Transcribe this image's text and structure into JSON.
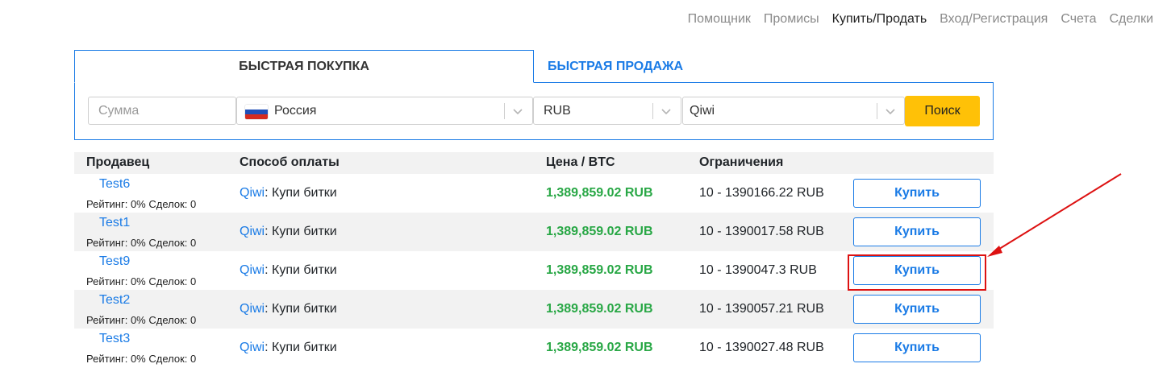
{
  "nav": {
    "items": [
      "Помощник",
      "Промисы",
      "Купить/Продать",
      "Вход/Регистрация",
      "Счета",
      "Сделки"
    ]
  },
  "tabs": {
    "buy": "БЫСТРАЯ ПОКУПКА",
    "sell": "БЫСТРАЯ ПРОДАЖА"
  },
  "search": {
    "amount_placeholder": "Сумма",
    "country": "Россия",
    "currency": "RUB",
    "payment": "Qiwi",
    "button": "Поиск"
  },
  "table": {
    "headers": {
      "seller": "Продавец",
      "payment": "Способ оплаты",
      "price": "Цена / BTC",
      "limits": "Ограничения"
    },
    "rows": [
      {
        "name": "Test6",
        "stats": "Рейтинг: 0% Сделок: 0",
        "method": "Qiwi",
        "method_suffix": ": Купи битки",
        "price": "1,389,859.02 RUB",
        "limits": "10 - 1390166.22 RUB",
        "button": "Купить"
      },
      {
        "name": "Test1",
        "stats": "Рейтинг: 0% Сделок: 0",
        "method": "Qiwi",
        "method_suffix": ": Купи битки",
        "price": "1,389,859.02 RUB",
        "limits": "10 - 1390017.58 RUB",
        "button": "Купить"
      },
      {
        "name": "Test9",
        "stats": "Рейтинг: 0% Сделок: 0",
        "method": "Qiwi",
        "method_suffix": ": Купи битки",
        "price": "1,389,859.02 RUB",
        "limits": "10 - 1390047.3 RUB",
        "button": "Купить"
      },
      {
        "name": "Test2",
        "stats": "Рейтинг: 0% Сделок: 0",
        "method": "Qiwi",
        "method_suffix": ": Купи битки",
        "price": "1,389,859.02 RUB",
        "limits": "10 - 1390057.21 RUB",
        "button": "Купить"
      },
      {
        "name": "Test3",
        "stats": "Рейтинг: 0% Сделок: 0",
        "method": "Qiwi",
        "method_suffix": ": Купи битки",
        "price": "1,389,859.02 RUB",
        "limits": "10 - 1390027.48 RUB",
        "button": "Купить"
      }
    ]
  },
  "colors": {
    "accent": "#1a7be6",
    "price": "#28a745",
    "search_button": "#ffc107",
    "annotation": "#dd1111"
  }
}
